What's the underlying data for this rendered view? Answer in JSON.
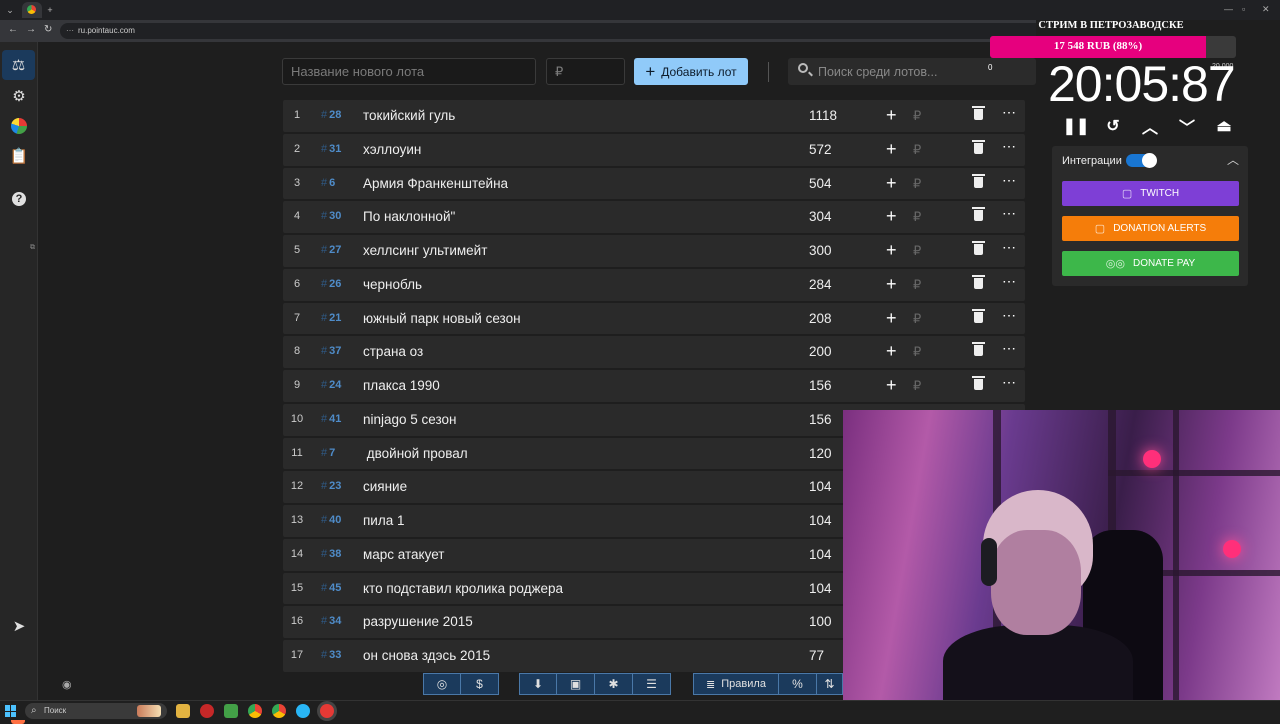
{
  "browser": {
    "url": "ru.pointauc.com"
  },
  "toolbar": {
    "lot_name_placeholder": "Название нового лота",
    "amount_placeholder": "₽",
    "add_lot_label": "Добавить лот",
    "search_placeholder": "Поиск среди лотов..."
  },
  "lots": [
    {
      "index": "1",
      "id": "28",
      "name": "токийский гуль",
      "amount": "1118"
    },
    {
      "index": "2",
      "id": "31",
      "name": "хэллоуин",
      "amount": "572"
    },
    {
      "index": "3",
      "id": "6",
      "name": "Армия Франкенштейна",
      "amount": "504"
    },
    {
      "index": "4",
      "id": "30",
      "name": "По наклонной\"",
      "amount": "304"
    },
    {
      "index": "5",
      "id": "27",
      "name": "хеллсинг ультимейт",
      "amount": "300"
    },
    {
      "index": "6",
      "id": "26",
      "name": "чернобль",
      "amount": "284"
    },
    {
      "index": "7",
      "id": "21",
      "name": "южный парк новый сезон",
      "amount": "208"
    },
    {
      "index": "8",
      "id": "37",
      "name": "страна оз",
      "amount": "200"
    },
    {
      "index": "9",
      "id": "24",
      "name": "плакса 1990",
      "amount": "156"
    },
    {
      "index": "10",
      "id": "41",
      "name": "ninjago 5 сезон",
      "amount": "156"
    },
    {
      "index": "11",
      "id": "7",
      "name": " двойной провал",
      "amount": "120"
    },
    {
      "index": "12",
      "id": "23",
      "name": "сияние",
      "amount": "104"
    },
    {
      "index": "13",
      "id": "40",
      "name": "пила 1",
      "amount": "104"
    },
    {
      "index": "14",
      "id": "38",
      "name": "марс атакует",
      "amount": "104"
    },
    {
      "index": "15",
      "id": "45",
      "name": "кто подставил кролика роджера",
      "amount": "104"
    },
    {
      "index": "16",
      "id": "34",
      "name": "разрушение 2015",
      "amount": "100"
    },
    {
      "index": "17",
      "id": "33",
      "name": "он снова здэсь 2015",
      "amount": "77"
    }
  ],
  "lot_row": {
    "hash_symbol": "#",
    "add_icon": "+",
    "currency_icon": "₽",
    "more_icon": "⋯"
  },
  "bottom_bar": {
    "github_icon": "github-icon",
    "donate_icon": "$",
    "rules_label": "Правила",
    "percent_icon": "%"
  },
  "stream": {
    "title": "СТРИМ В ПЕТРОЗАВОДСКЕ",
    "goal_text": "17 548 RUB (88%)",
    "goal_progress": 0.88,
    "counter_left": "0",
    "counter_right": "20 000"
  },
  "timer": {
    "value": "20:05:87"
  },
  "integrations": {
    "label": "Интеграции",
    "enabled": true,
    "twitch_label": "TWITCH",
    "donation_alerts_label": "DONATION ALERTS",
    "donate_pay_label": "DONATE PAY",
    "colors": {
      "twitch": "#7e3fd6",
      "donation_alerts": "#f57d0a",
      "donate_pay": "#3db74a"
    }
  },
  "taskbar": {
    "search_placeholder": "Поиск"
  },
  "colors": {
    "accent": "#90caf9",
    "goal": "#e6007e"
  }
}
